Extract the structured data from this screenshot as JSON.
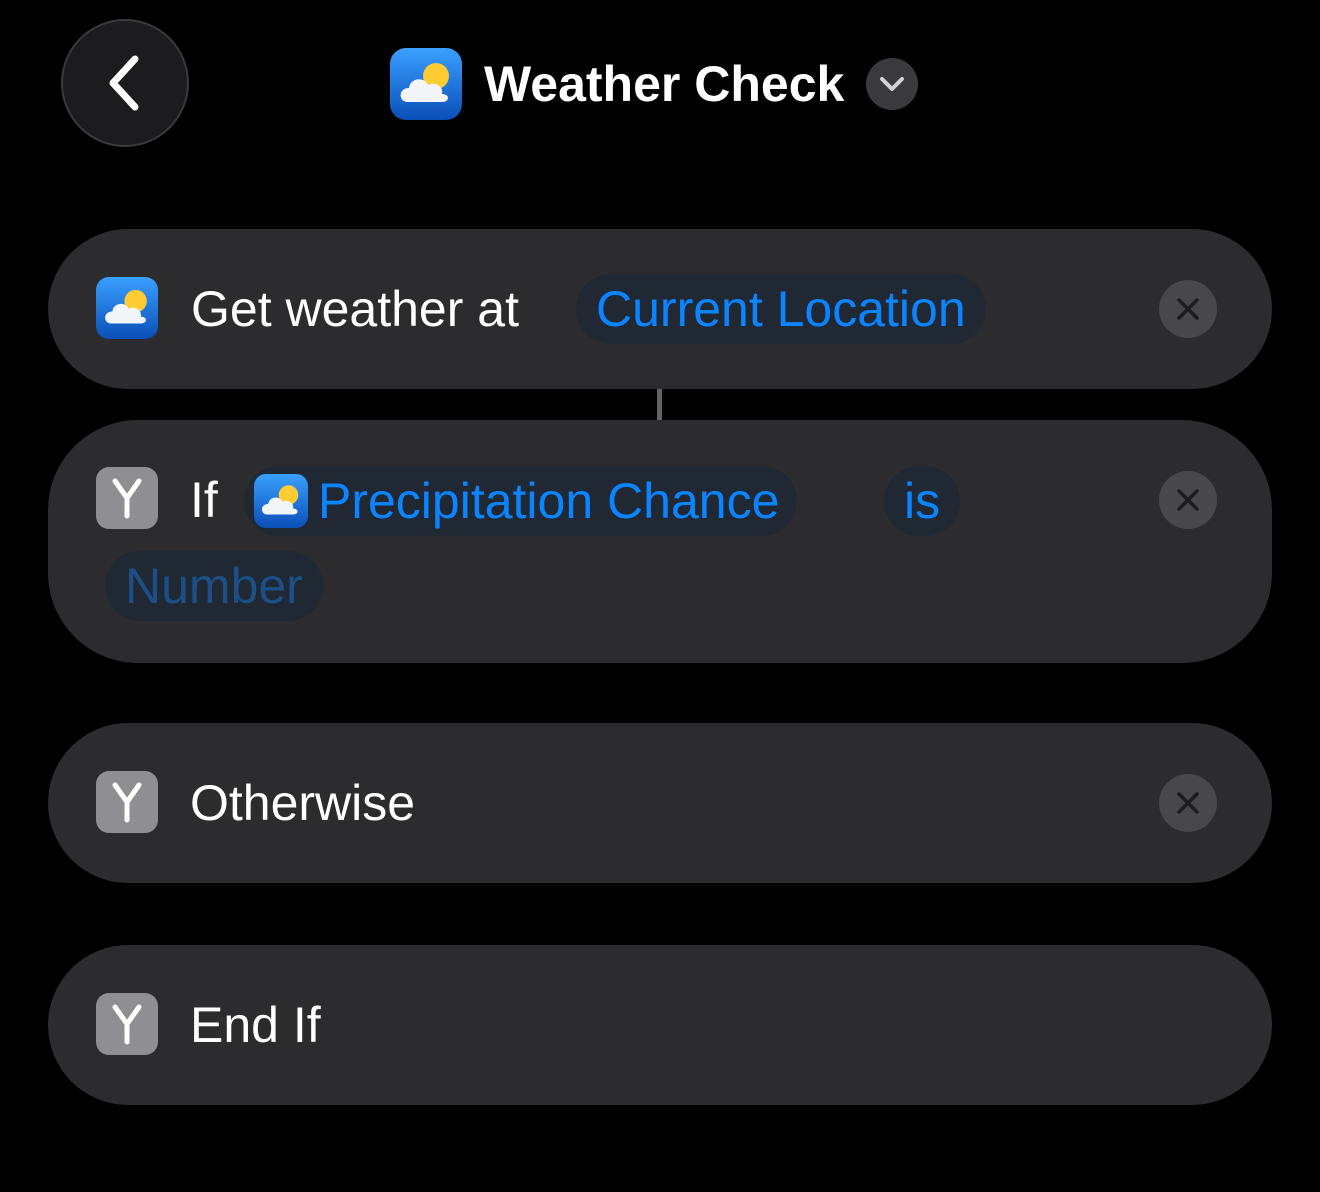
{
  "header": {
    "title": "Weather Check"
  },
  "actions": {
    "get_weather": {
      "label": "Get weather at",
      "location_token": "Current Location"
    },
    "if_block": {
      "label": "If",
      "variable_token": "Precipitation Chance",
      "operator_token": "is",
      "value_placeholder": "Number"
    },
    "otherwise": {
      "label": "Otherwise"
    },
    "end_if": {
      "label": "End If"
    }
  },
  "colors": {
    "background": "#000000",
    "card": "#2c2c2e",
    "accent_blue": "#0a84ff",
    "token_background": "#1f2833",
    "placeholder_blue": "#1b4f85",
    "scripting_icon_gray": "#8e8e93",
    "remove_button": "#48484a"
  },
  "icons": {
    "back": "chevron-left-icon",
    "weather_app": "weather-app-icon",
    "title_menu": "chevron-down-icon",
    "scripting": "if-branch-icon",
    "remove": "close-icon"
  }
}
